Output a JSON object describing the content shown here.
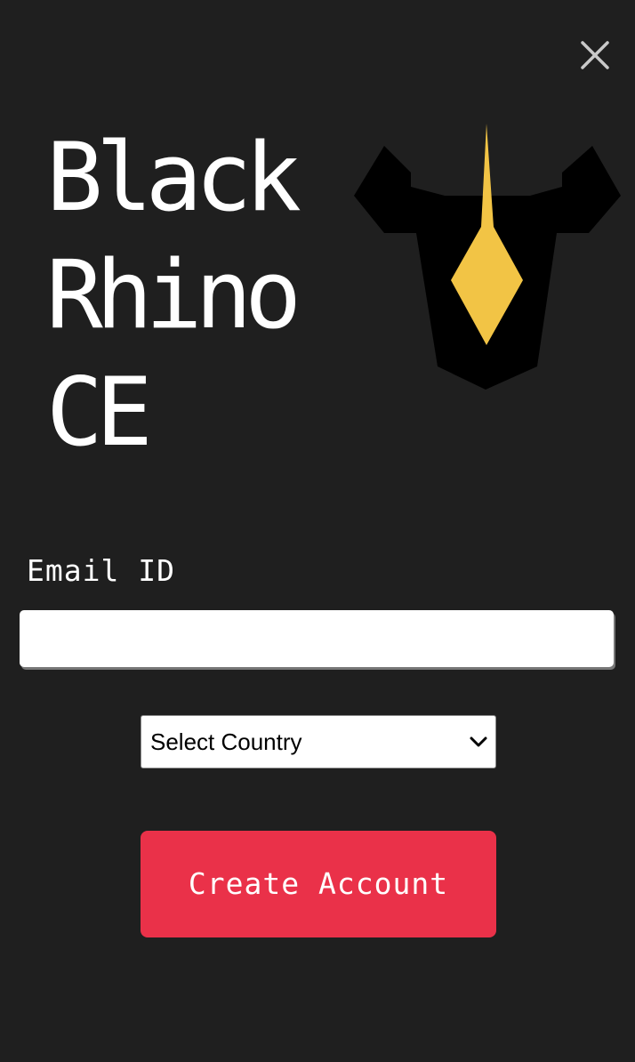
{
  "header": {
    "close_icon": "close-icon"
  },
  "brand": {
    "title_lines": [
      "Black",
      "Rhino",
      "CE"
    ],
    "logo_icon": "rhino-head-logo",
    "logo_colors": {
      "head": "#000000",
      "horn": "#f2c445"
    }
  },
  "form": {
    "email_label": "Email ID",
    "email_value": "",
    "email_placeholder": "",
    "country_select": {
      "selected": "Select Country",
      "icon": "chevron-down-icon"
    },
    "submit_label": "Create Account"
  },
  "colors": {
    "background": "#1f1f1f",
    "accent": "#ea3149",
    "text": "#ffffff"
  }
}
